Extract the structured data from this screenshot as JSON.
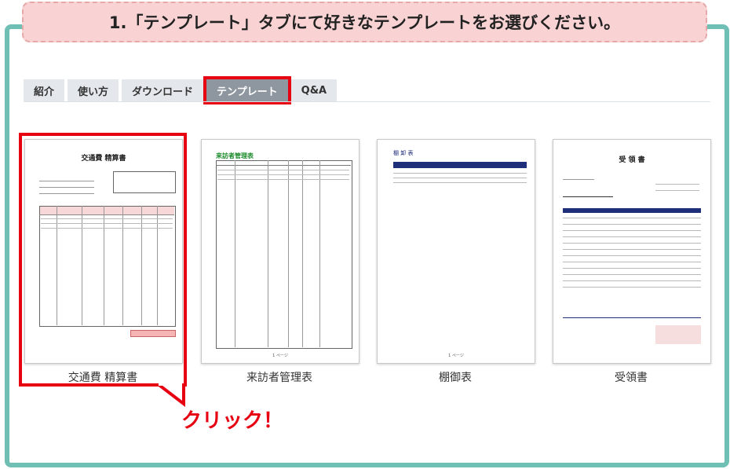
{
  "banner": {
    "title": "1.「テンプレート」タブにて好きなテンプレートをお選びください。"
  },
  "tabs": [
    {
      "label": "紹介"
    },
    {
      "label": "使い方"
    },
    {
      "label": "ダウンロード"
    },
    {
      "label": "テンプレート"
    },
    {
      "label": "Q&A"
    }
  ],
  "active_tab": "テンプレート",
  "templates": [
    {
      "title": "交通費 精算書",
      "doc_heading": "交通費 精算書"
    },
    {
      "title": "来訪者管理表",
      "doc_heading": "来訪者管理表"
    },
    {
      "title": "棚御表",
      "doc_heading": "棚 卸 表"
    },
    {
      "title": "受領書",
      "doc_heading": "受 領 書"
    }
  ],
  "page_footer": "1 ページ",
  "annotation": {
    "text": "クリック！"
  },
  "colors": {
    "frame": "#6fbfb5",
    "banner_bg": "#f9d3d3",
    "highlight": "#e60012",
    "tab_active": "#8e979f",
    "tab_bg": "#e4e8ec",
    "doc_navy": "#1f2f7a",
    "doc_green": "#1a8a2a"
  }
}
